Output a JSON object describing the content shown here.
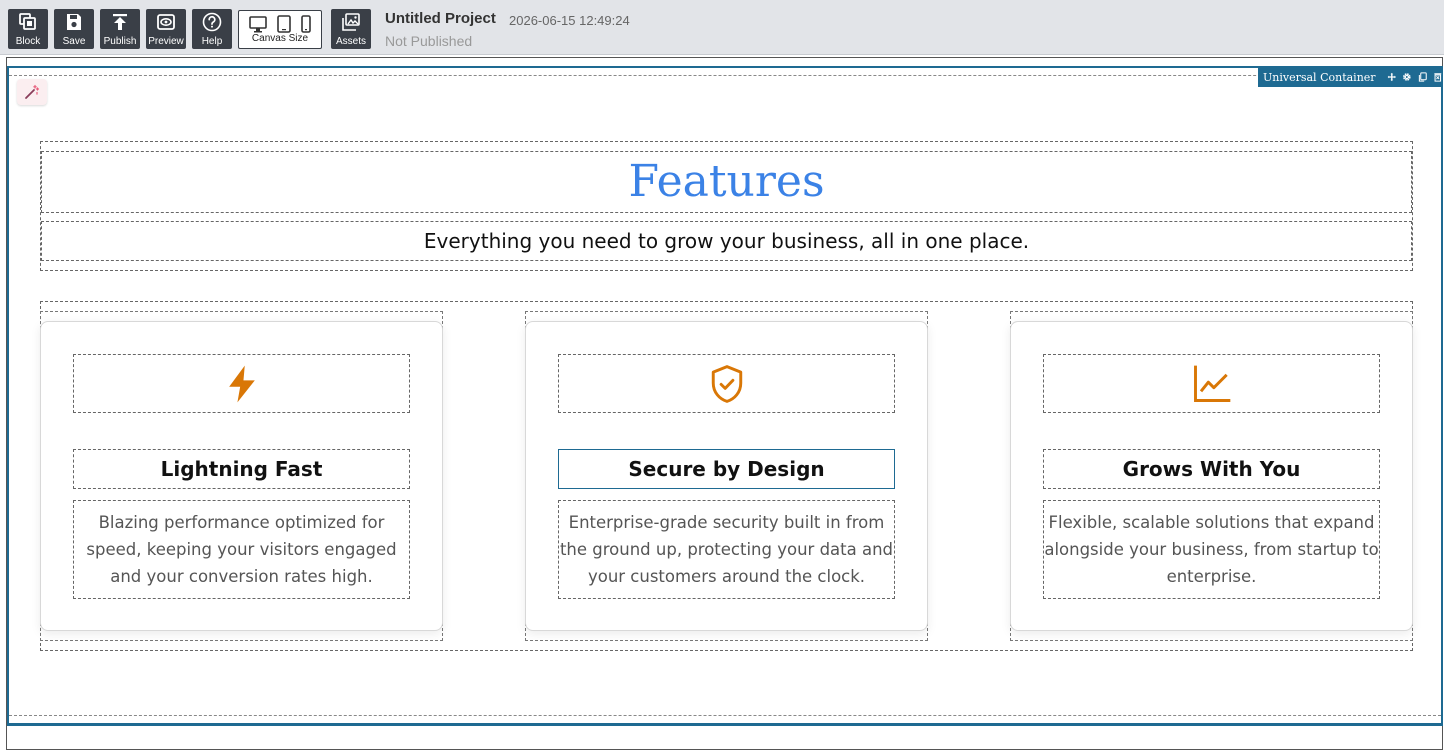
{
  "toolbar": {
    "buttons": [
      {
        "label": "Block",
        "icon": "blocks-icon"
      },
      {
        "label": "Save",
        "icon": "save-icon"
      },
      {
        "label": "Publish",
        "icon": "publish-icon"
      },
      {
        "label": "Preview",
        "icon": "preview-icon"
      },
      {
        "label": "Help",
        "icon": "help-icon"
      }
    ],
    "canvas_size_label": "Canvas Size",
    "devices": [
      "desktop-icon",
      "tablet-icon",
      "mobile-icon"
    ],
    "assets_label": "Assets",
    "project_title": "Untitled Project",
    "project_date": "2026-06-15 12:49:24",
    "project_status": "Not Published"
  },
  "editor": {
    "container_label": "Universal Container",
    "badge_icons": [
      "move-icon",
      "settings-gear-icon",
      "duplicate-icon",
      "delete-icon"
    ],
    "accent_color": "#1e6a92"
  },
  "content": {
    "title": "Features",
    "title_color": "#3b82e6",
    "subtitle": "Everything you need to grow your business, all in one place.",
    "icon_color": "#d97706",
    "cards": [
      {
        "icon": "lightning-bolt-icon",
        "heading": "Lightning Fast",
        "text": "Blazing performance optimized for speed, keeping your visitors engaged and your conversion rates high."
      },
      {
        "icon": "shield-check-icon",
        "heading": "Secure by Design",
        "text": "Enterprise-grade security built in from the ground up, protecting your data and your customers around the clock."
      },
      {
        "icon": "line-chart-icon",
        "heading": "Grows With You",
        "text": "Flexible, scalable solutions that expand alongside your business, from startup to enterprise."
      }
    ]
  }
}
